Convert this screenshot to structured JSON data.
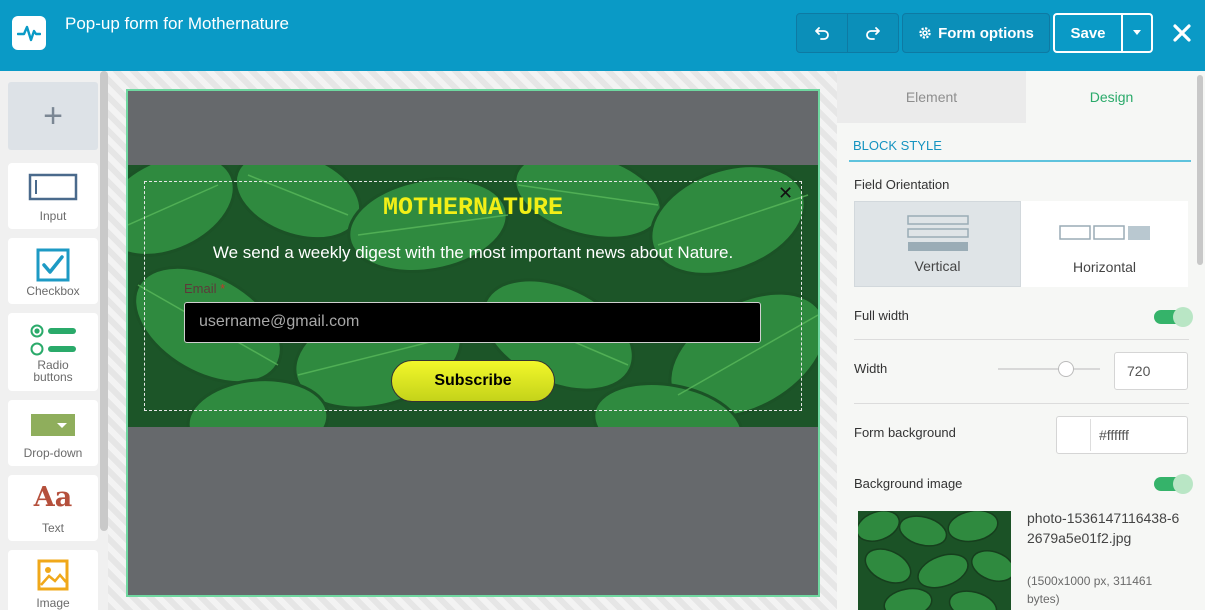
{
  "header": {
    "title": "Pop-up form for Mothernature",
    "form_options_label": "Form options",
    "save_label": "Save",
    "brand_color": "#0a9ac6"
  },
  "toolbox": {
    "items": [
      {
        "label": "Input",
        "icon": "input-icon"
      },
      {
        "label": "Checkbox",
        "icon": "checkbox-icon"
      },
      {
        "label": "Radio buttons",
        "icon": "radio-icon"
      },
      {
        "label": "Drop-down",
        "icon": "dropdown-icon"
      },
      {
        "label": "Text",
        "icon": "text-icon"
      },
      {
        "label": "Image",
        "icon": "image-icon"
      }
    ],
    "text_icon_glyph": "Aa",
    "add_glyph": "+"
  },
  "popup": {
    "title": "MOTHERNATURE",
    "description": "We send a weekly digest with the most important news about Nature.",
    "email_label": "Email",
    "required_mark": "*",
    "email_placeholder": "username@gmail.com",
    "button_label": "Subscribe",
    "close_glyph": "✕",
    "title_color": "#f2ef17"
  },
  "panel": {
    "tabs": [
      "Element",
      "Design"
    ],
    "active_tab": "Design",
    "section_title": "BLOCK STYLE",
    "field_orientation_label": "Field Orientation",
    "orientation_options": [
      "Vertical",
      "Horizontal"
    ],
    "selected_orientation": "Vertical",
    "full_width_label": "Full width",
    "full_width_on": true,
    "width_label": "Width",
    "width_value": "720",
    "form_background_label": "Form background",
    "form_background_value": "#ffffff",
    "background_image_label": "Background image",
    "background_image_on": true,
    "image_filename": "photo-1536147116438-62679a5e01f2.jpg",
    "image_meta": "(1500x1000 px, 311461 bytes)"
  }
}
